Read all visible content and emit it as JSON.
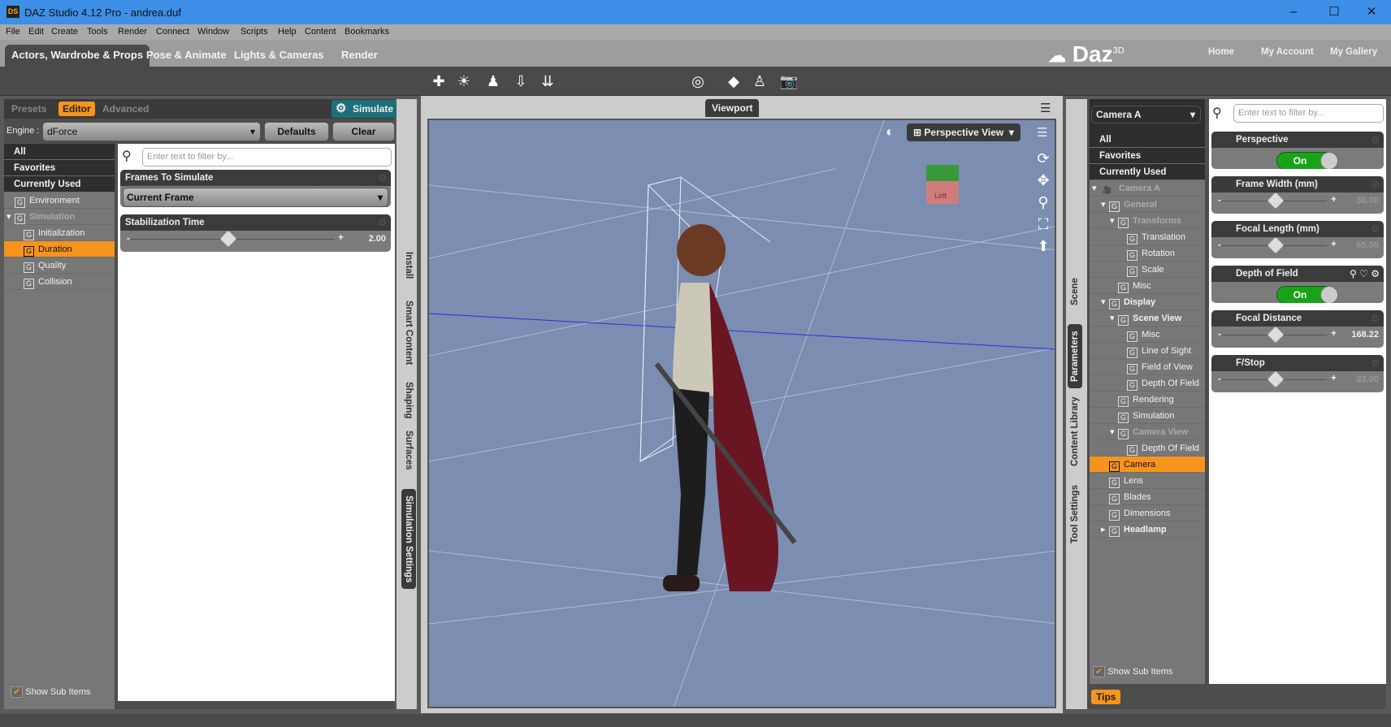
{
  "window": {
    "title": "DAZ Studio 4.12 Pro - andrea.duf",
    "logo": "DS",
    "minimize": "–",
    "maximize": "☐",
    "close": "✕"
  },
  "menu": [
    "File",
    "Edit",
    "Create",
    "Tools",
    "Render",
    "Connect",
    "Window",
    "Scripts",
    "Help",
    "Content",
    "Bookmarks"
  ],
  "tabs": [
    {
      "label": "Actors, Wardrobe & Props",
      "active": true
    },
    {
      "label": "Pose & Animate"
    },
    {
      "label": "Lights & Cameras"
    },
    {
      "label": "Render"
    }
  ],
  "brand": {
    "logo": "Daz",
    "sup": "3D",
    "links": [
      "Home",
      "My Account",
      "My Gallery"
    ]
  },
  "toolbar_icons": [
    "new-figure-icon",
    "scene-lighting-icon",
    "figure-pose-icon",
    "load-merge-icon",
    "load-file-icon",
    "camera-rotate-icon",
    "node-select-icon",
    "figure-select-icon",
    "camera-capture-icon"
  ],
  "left_panel": {
    "subtabs": [
      "Presets",
      "Editor",
      "Advanced"
    ],
    "active_subtab": "Editor",
    "simulate_label": "Simulate",
    "engine_label": "Engine :",
    "engine_value": "dForce",
    "defaults_label": "Defaults",
    "clear_label": "Clear",
    "filter_placeholder": "Enter text to filter by...",
    "tree": [
      {
        "label": "All",
        "type": "header"
      },
      {
        "label": "Favorites",
        "type": "header"
      },
      {
        "label": "Currently Used",
        "type": "header"
      },
      {
        "label": "Environment",
        "level": 0
      },
      {
        "label": "Simulation",
        "level": 0,
        "expanded": true,
        "dim": true
      },
      {
        "label": "Initialization",
        "level": 1
      },
      {
        "label": "Duration",
        "level": 1,
        "selected": true
      },
      {
        "label": "Quality",
        "level": 1
      },
      {
        "label": "Collision",
        "level": 1
      }
    ],
    "show_sub_items": "Show Sub Items",
    "params": [
      {
        "name": "Frames To Simulate",
        "type": "select",
        "value": "Current Frame"
      },
      {
        "name": "Stabilization Time",
        "type": "slider",
        "value": "2.00",
        "fraction": 0.45
      }
    ],
    "side_tabs": [
      "Install",
      "Smart Content",
      "Shaping",
      "Surfaces",
      "Simulation Settings"
    ],
    "active_side_tab": "Simulation Settings"
  },
  "viewport": {
    "title": "Viewport",
    "view_label": "Perspective View",
    "cube_label": "Left",
    "bg": "#7b8db0"
  },
  "right_panel": {
    "side_tabs": [
      "Scene",
      "Parameters",
      "Content Library",
      "Tool Settings"
    ],
    "active_side_tab": "Parameters",
    "node_select": "Camera A",
    "filter_placeholder": "Enter text to filter by...",
    "tree": [
      {
        "label": "All",
        "type": "header"
      },
      {
        "label": "Favorites",
        "type": "header"
      },
      {
        "label": "Currently Used",
        "type": "header"
      },
      {
        "label": "Camera A",
        "level": 0,
        "expanded": true,
        "dim": true,
        "icon": "camera"
      },
      {
        "label": "General",
        "level": 1,
        "expanded": true,
        "dim": true
      },
      {
        "label": "Transforms",
        "level": 2,
        "expanded": true,
        "dim": true
      },
      {
        "label": "Translation",
        "level": 3
      },
      {
        "label": "Rotation",
        "level": 3
      },
      {
        "label": "Scale",
        "level": 3
      },
      {
        "label": "Misc",
        "level": 2
      },
      {
        "label": "Display",
        "level": 1,
        "expanded": true,
        "bold": true
      },
      {
        "label": "Scene View",
        "level": 2,
        "expanded": true,
        "bold": true
      },
      {
        "label": "Misc",
        "level": 3
      },
      {
        "label": "Line of Sight",
        "level": 3
      },
      {
        "label": "Field of View",
        "level": 3
      },
      {
        "label": "Depth Of Field",
        "level": 3
      },
      {
        "label": "Rendering",
        "level": 2
      },
      {
        "label": "Simulation",
        "level": 2
      },
      {
        "label": "Camera View",
        "level": 2,
        "expanded": true,
        "dim": true
      },
      {
        "label": "Depth Of Field",
        "level": 3
      },
      {
        "label": "Camera",
        "level": 1,
        "selected": true
      },
      {
        "label": "Lens",
        "level": 1
      },
      {
        "label": "Blades",
        "level": 1
      },
      {
        "label": "Dimensions",
        "level": 1
      },
      {
        "label": "Headlamp",
        "level": 1,
        "collapsed": true,
        "bold": true
      }
    ],
    "show_sub_items": "Show Sub Items",
    "tips_label": "Tips",
    "params": [
      {
        "name": "Perspective",
        "type": "toggle",
        "value": "On"
      },
      {
        "name": "Frame Width (mm)",
        "type": "slider",
        "value": "36.00",
        "fraction": 0.45,
        "dim": true
      },
      {
        "name": "Focal Length (mm)",
        "type": "slider",
        "value": "65.00",
        "fraction": 0.45,
        "dim": true
      },
      {
        "name": "Depth of Field",
        "type": "toggle",
        "value": "On",
        "icons": true
      },
      {
        "name": "Focal Distance",
        "type": "slider",
        "value": "168.22",
        "fraction": 0.45
      },
      {
        "name": "F/Stop",
        "type": "slider",
        "value": "22.00",
        "fraction": 0.45,
        "dim": true
      }
    ]
  }
}
